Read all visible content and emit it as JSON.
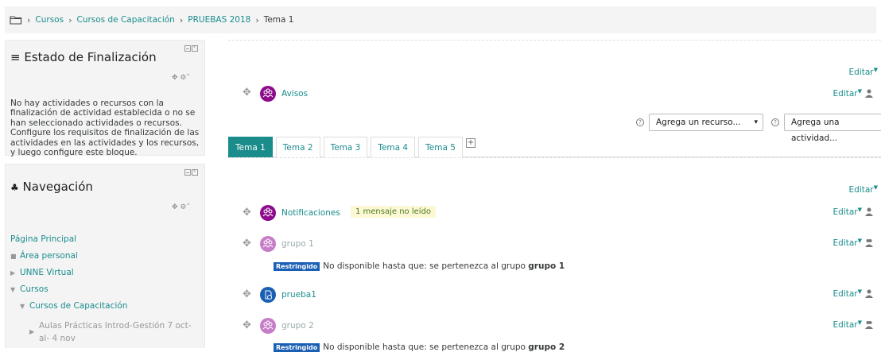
{
  "breadcrumb": [
    "Cursos",
    "Cursos de Capacitación",
    "PRUEBAS 2018",
    "Tema 1"
  ],
  "completion_block": {
    "title": "Estado de Finalización",
    "text": "No hay actividades o recursos con la finalización de actividad establecida o no se han seleccionado actividades o recursos. Configure los requisitos de finalización de las actividades en las actividades y los recursos, y luego configure este bloque."
  },
  "nav_block": {
    "title": "Navegación",
    "items": [
      "Página Principal",
      "Área personal",
      "UNNE Virtual",
      "Cursos",
      "Cursos de Capacitación",
      "Aulas Prácticas Introd-Gestión 7 oct-al- 4 nov"
    ]
  },
  "edit_label": "Editar",
  "activities_top": {
    "avisos": "Avisos"
  },
  "adders": {
    "resource": "Agrega un recurso...",
    "activity": "Agrega una actividad..."
  },
  "tabs": [
    "Tema 1",
    "Tema 2",
    "Tema 3",
    "Tema 4",
    "Tema 5"
  ],
  "activities": {
    "notificaciones": "Notificaciones",
    "unread": "1 mensaje no leído",
    "grupo1": "grupo 1",
    "prueba1": "prueba1",
    "grupo2": "grupo 2"
  },
  "restriction": {
    "tag": "Restringido",
    "text": "No disponible hasta que: se pertenezca al grupo",
    "group1": "grupo 1",
    "group2": "grupo 2"
  },
  "colors": {
    "accent": "#1a8c8c",
    "forum_icon": "#8e0c8c",
    "restricted_tag": "#1a5fb4"
  }
}
